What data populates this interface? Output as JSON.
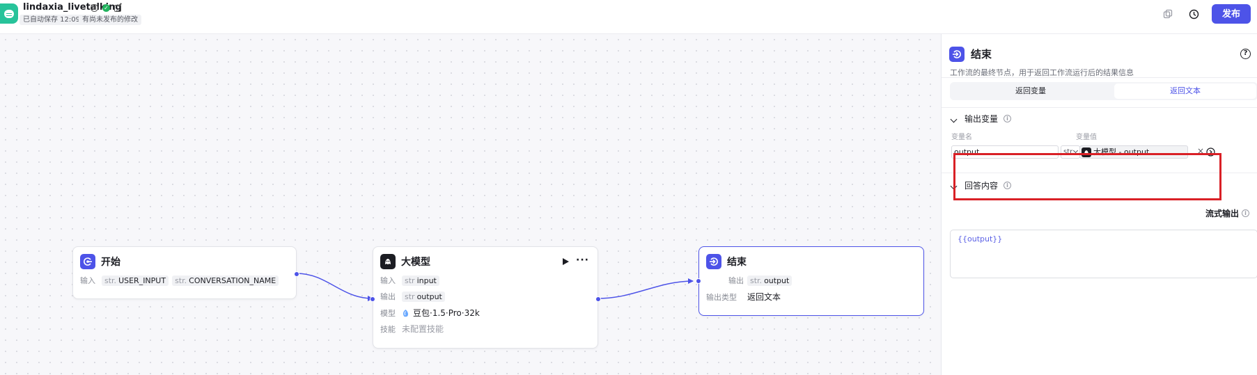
{
  "header": {
    "app_name": "lindaxia_livetalking",
    "autosave_text": "已自动保存 12:09:42",
    "unpublished_text": "有尚未发布的修改",
    "publish_label": "发布"
  },
  "nodes": {
    "start": {
      "title": "开始",
      "input_label": "输入",
      "type_label": "str.",
      "vars": [
        "USER_INPUT",
        "CONVERSATION_NAME"
      ]
    },
    "llm": {
      "title": "大模型",
      "input_label": "输入",
      "input_type": "str",
      "input_var": "input",
      "output_label": "输出",
      "output_type": "str",
      "output_var": "output",
      "model_label": "模型",
      "model_value": "豆包·1.5·Pro·32k",
      "skill_label": "技能",
      "skill_value": "未配置技能",
      "more_label": "···"
    },
    "end": {
      "title": "结束",
      "output_label": "输出",
      "output_type": "str.",
      "output_var": "output",
      "output_type_label": "输出类型",
      "output_type_value": "返回文本"
    }
  },
  "panel": {
    "title": "结束",
    "description": "工作流的最终节点，用于返回工作流运行后的结果信息",
    "help_label": "?",
    "tabs": [
      "返回变量",
      "返回文本"
    ],
    "active_tab": 1,
    "output_vars": {
      "section_title": "输出变量",
      "name_header": "变量名",
      "value_header": "变量值",
      "row": {
        "name": "output",
        "type": "str.",
        "ref": "大模型 - output",
        "clear": "×"
      }
    },
    "answer": {
      "section_title": "回答内容",
      "stream_label": "流式输出",
      "content": "{{output}}"
    }
  },
  "colors": {
    "accent": "#4d53e8",
    "highlight_box": "#d92026",
    "brand_green": "#27c39a",
    "success": "#22b35e"
  }
}
